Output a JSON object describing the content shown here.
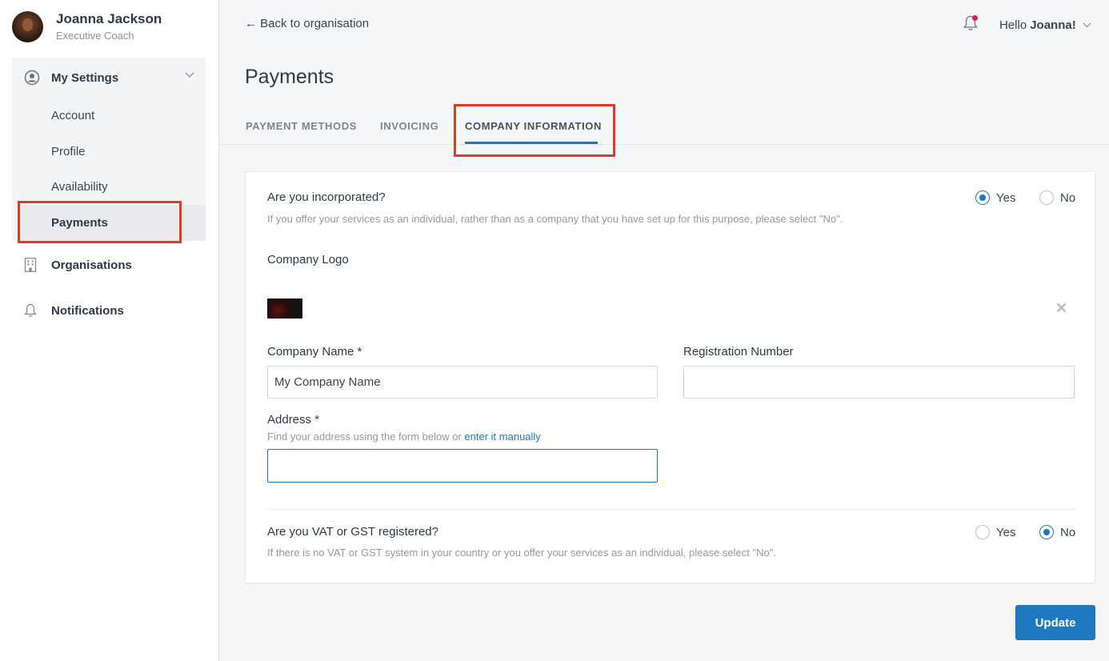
{
  "user": {
    "name": "Joanna Jackson",
    "role": "Executive Coach"
  },
  "sidebar": {
    "section_label": "My Settings",
    "sub_items": [
      "Account",
      "Profile",
      "Availability",
      "Payments"
    ],
    "active_item": "Payments",
    "nav_items": [
      {
        "label": "Organisations",
        "icon": "building-icon"
      },
      {
        "label": "Notifications",
        "icon": "bell-icon"
      }
    ]
  },
  "header": {
    "back_link": "← Back to organisation",
    "greeting": "Hello",
    "greeting_name": "Joanna!"
  },
  "page": {
    "title": "Payments",
    "tabs": [
      "PAYMENT METHODS",
      "INVOICING",
      "COMPANY INFORMATION"
    ],
    "active_tab": "COMPANY INFORMATION"
  },
  "form": {
    "incorporated": {
      "question": "Are you incorporated?",
      "hint": "If you offer your services as an individual, rather than as a company that you have set up for this purpose, please select \"No\".",
      "yes_label": "Yes",
      "no_label": "No",
      "selected": "Yes"
    },
    "logo_label": "Company Logo",
    "company_name": {
      "label": "Company Name *",
      "value": "My Company Name"
    },
    "registration_number": {
      "label": "Registration Number",
      "value": ""
    },
    "address": {
      "label": "Address *",
      "hint_prefix": "Find your address using the form below or",
      "hint_link": "enter it manually",
      "value": ""
    },
    "vat": {
      "question": "Are you VAT or GST registered?",
      "hint": "If there is no VAT or GST system in your country or you offer your services as an individual, please select \"No\".",
      "yes_label": "Yes",
      "no_label": "No",
      "selected": "No"
    }
  },
  "actions": {
    "update_label": "Update"
  },
  "colors": {
    "accent": "#1f78c2",
    "highlight": "#e03a23",
    "notification_dot": "#d6204a"
  }
}
